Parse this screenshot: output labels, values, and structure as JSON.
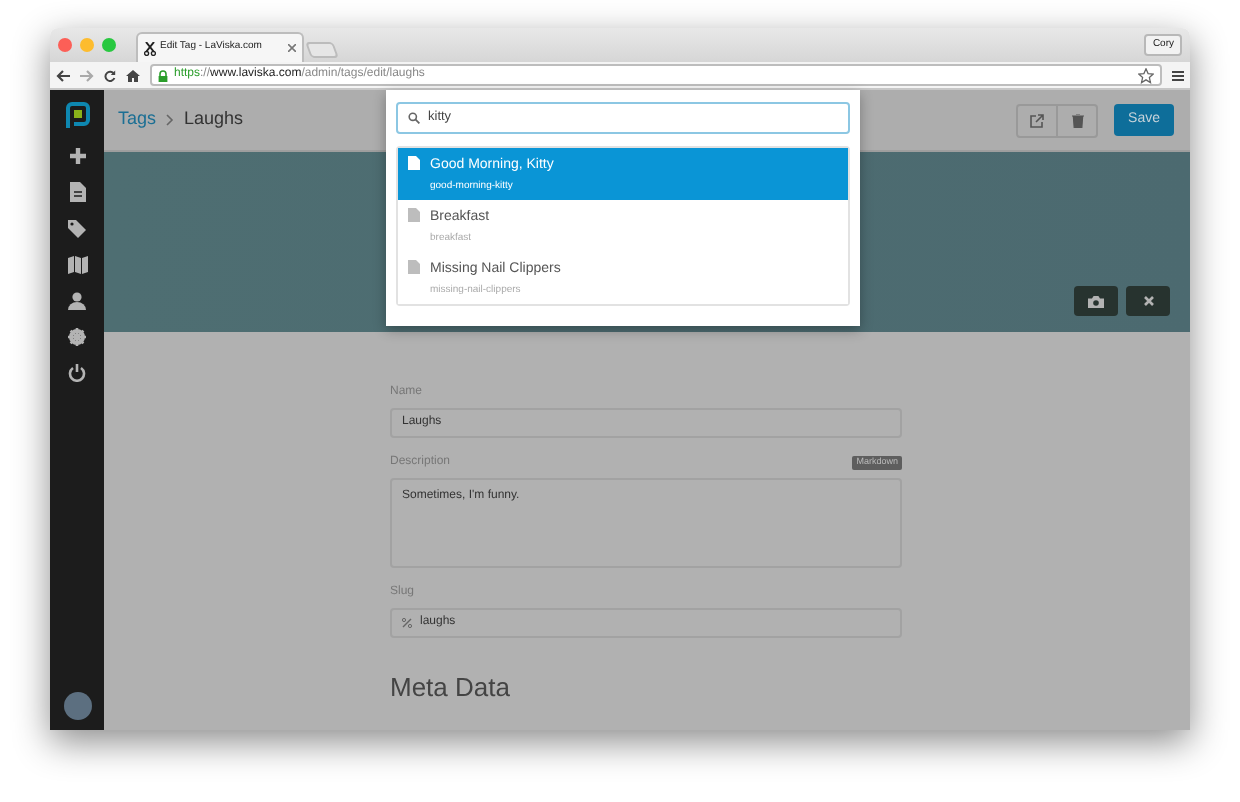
{
  "browser": {
    "tab_title": "Edit Tag - LaViska.com",
    "profile": "Cory",
    "url_scheme": "https",
    "url_separator": "://",
    "url_host": "www.laviska.com",
    "url_path": "/admin/tags/edit/laughs"
  },
  "header": {
    "breadcrumb": [
      "Tags",
      "Laughs"
    ],
    "save": "Save"
  },
  "search": {
    "value": "kitty",
    "results": [
      {
        "title": "Good Morning, Kitty",
        "slug": "good-morning-kitty",
        "selected": true
      },
      {
        "title": "Breakfast",
        "slug": "breakfast",
        "selected": false
      },
      {
        "title": "Missing Nail Clippers",
        "slug": "missing-nail-clippers",
        "selected": false
      }
    ]
  },
  "form": {
    "name": {
      "label": "Name",
      "value": "Laughs"
    },
    "description": {
      "label": "Description",
      "badge": "Markdown",
      "value": "Sometimes, I'm funny."
    },
    "slug": {
      "label": "Slug",
      "value": "laughs"
    },
    "section_heading": "Meta Data"
  }
}
